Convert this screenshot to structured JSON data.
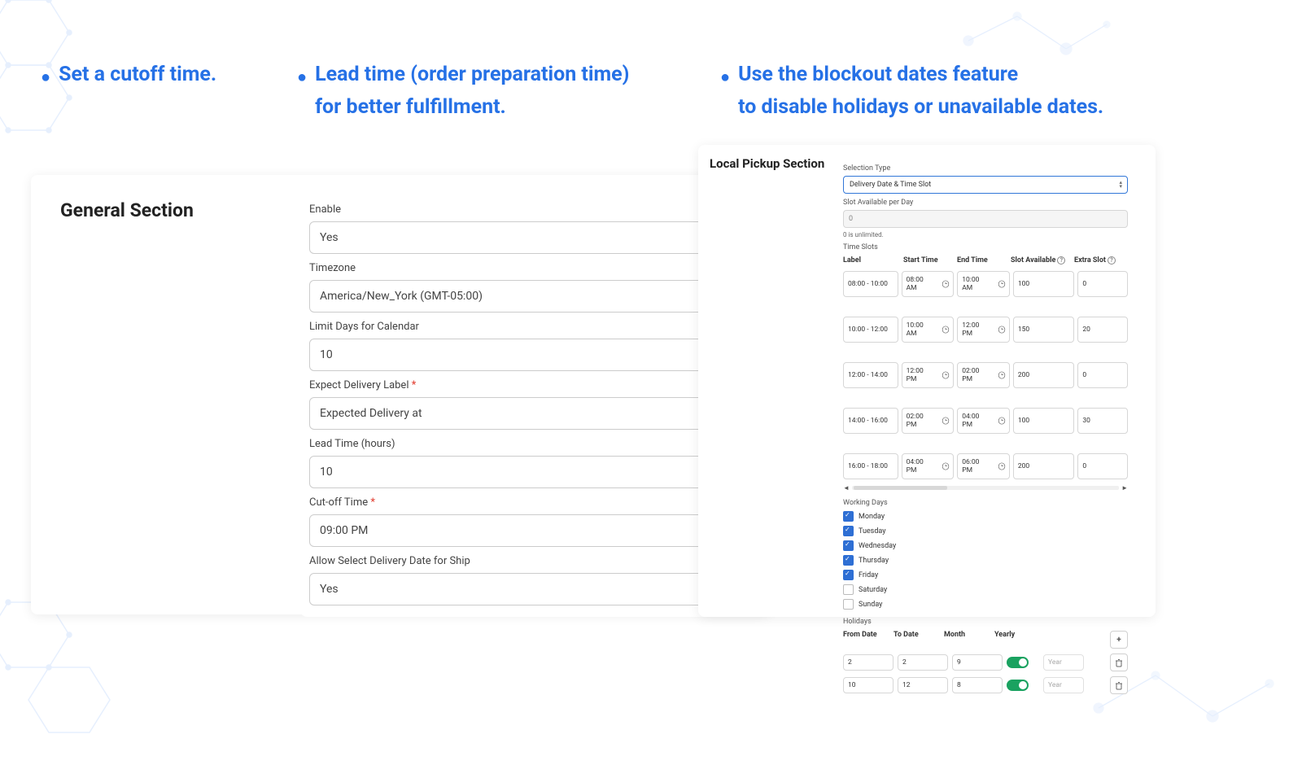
{
  "features": {
    "f1": "Set a cutoff time.",
    "f2_l1": "Lead time (order preparation time)",
    "f2_l2": "for better fulfillment.",
    "f3_l1": "Use the blockout dates feature",
    "f3_l2": "to disable holidays or unavailable dates."
  },
  "general": {
    "title": "General Section",
    "labels": {
      "enable": "Enable",
      "timezone": "Timezone",
      "limit_days": "Limit Days for Calendar",
      "expect_label": "Expect Delivery Label",
      "lead_time": "Lead Time (hours)",
      "cutoff": "Cut-off Time",
      "allow_select": "Allow Select Delivery Date for Ship"
    },
    "values": {
      "enable": "Yes",
      "timezone": "America/New_York (GMT-05:00)",
      "limit_days": "10",
      "expect_label": "Expected Delivery at",
      "lead_time": "10",
      "cutoff": "09:00 PM",
      "allow_select": "Yes"
    }
  },
  "pickup": {
    "title": "Local Pickup Section",
    "sel_type_label": "Selection Type",
    "sel_type_value": "Delivery Date & Time Slot",
    "slot_avail_label": "Slot Available per Day",
    "slot_avail_value": "0",
    "slot_avail_hint": "0 is unlimited.",
    "ts_label": "Time Slots",
    "ts_headers": {
      "label": "Label",
      "start": "Start Time",
      "end": "End Time",
      "avail": "Slot Available",
      "extra": "Extra Slot"
    },
    "time_slots": [
      {
        "label": "08:00 - 10:00",
        "start": "08:00 AM",
        "end": "10:00 AM",
        "avail": "100",
        "extra": "0"
      },
      {
        "label": "10:00 - 12:00",
        "start": "10:00 AM",
        "end": "12:00 PM",
        "avail": "150",
        "extra": "20"
      },
      {
        "label": "12:00 - 14:00",
        "start": "12:00 PM",
        "end": "02:00 PM",
        "avail": "200",
        "extra": "0"
      },
      {
        "label": "14:00 - 16:00",
        "start": "02:00 PM",
        "end": "04:00 PM",
        "avail": "100",
        "extra": "30"
      },
      {
        "label": "16:00 - 18:00",
        "start": "04:00 PM",
        "end": "06:00 PM",
        "avail": "200",
        "extra": "0"
      }
    ],
    "wd_label": "Working Days",
    "working_days": [
      {
        "name": "Monday",
        "checked": true
      },
      {
        "name": "Tuesday",
        "checked": true
      },
      {
        "name": "Wednesday",
        "checked": true
      },
      {
        "name": "Thursday",
        "checked": true
      },
      {
        "name": "Friday",
        "checked": true
      },
      {
        "name": "Saturday",
        "checked": false
      },
      {
        "name": "Sunday",
        "checked": false
      }
    ],
    "hol_label": "Holidays",
    "hol_headers": {
      "from": "From Date",
      "to": "To Date",
      "month": "Month",
      "yearly": "Yearly"
    },
    "holidays": [
      {
        "from": "2",
        "to": "2",
        "month": "9",
        "yearly": true,
        "year": "Year"
      },
      {
        "from": "10",
        "to": "12",
        "month": "8",
        "yearly": true,
        "year": "Year"
      }
    ],
    "icons": {
      "add": "+",
      "scroll_left": "◄",
      "scroll_right": "►"
    }
  }
}
